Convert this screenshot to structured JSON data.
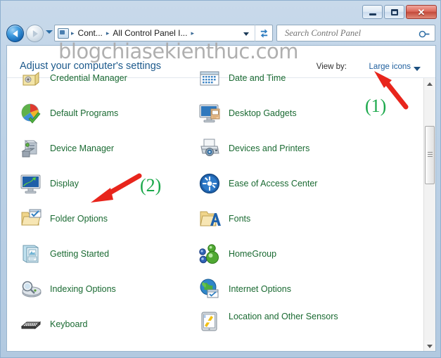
{
  "window": {
    "controls": {
      "minimize_label": "Minimize",
      "maximize_label": "Maximize",
      "close_label": "✕"
    }
  },
  "nav": {
    "back_label": "Back",
    "forward_label": "Forward",
    "history_label": "Recent pages",
    "refresh_label": "Refresh"
  },
  "address": {
    "icon": "control-panel-icon",
    "crumbs": [
      {
        "label": "Cont...",
        "sep": "▸"
      },
      {
        "label": "All Control Panel I...",
        "sep": "▸"
      }
    ],
    "sep_lead": "▸"
  },
  "search": {
    "placeholder": "Search Control Panel",
    "value": "",
    "icon": "search-icon"
  },
  "header": {
    "title": "Adjust your computer's settings",
    "view_by_label": "View by:",
    "view_by_value": "Large icons"
  },
  "watermark": {
    "text": "blogchiasekienthuc.com"
  },
  "items": {
    "left": [
      {
        "label": "Credential Manager",
        "icon": "credential-manager-icon",
        "cut": true
      },
      {
        "label": "Default Programs",
        "icon": "default-programs-icon"
      },
      {
        "label": "Device Manager",
        "icon": "device-manager-icon"
      },
      {
        "label": "Display",
        "icon": "display-icon"
      },
      {
        "label": "Folder Options",
        "icon": "folder-options-icon"
      },
      {
        "label": "Getting Started",
        "icon": "getting-started-icon"
      },
      {
        "label": "Indexing Options",
        "icon": "indexing-options-icon"
      },
      {
        "label": "Keyboard",
        "icon": "keyboard-icon"
      }
    ],
    "right": [
      {
        "label": "Date and Time",
        "icon": "date-and-time-icon",
        "cut": true
      },
      {
        "label": "Desktop Gadgets",
        "icon": "desktop-gadgets-icon"
      },
      {
        "label": "Devices and Printers",
        "icon": "devices-and-printers-icon"
      },
      {
        "label": "Ease of Access Center",
        "icon": "ease-of-access-center-icon"
      },
      {
        "label": "Fonts",
        "icon": "fonts-icon"
      },
      {
        "label": "HomeGroup",
        "icon": "homegroup-icon"
      },
      {
        "label": "Internet Options",
        "icon": "internet-options-icon"
      },
      {
        "label": "Location and Other Sensors",
        "icon": "location-sensors-icon"
      }
    ]
  },
  "annotations": {
    "one": {
      "text": "(1)",
      "color": "#1aa84a",
      "arrow_color": "#e8251c"
    },
    "two": {
      "text": "(2)",
      "color": "#1aa84a",
      "arrow_color": "#e8251c"
    }
  },
  "colors": {
    "link_green": "#1a6a32",
    "title_blue": "#1d5a8c",
    "accent_blue": "#1f5f9e",
    "annotation_red": "#e8251c",
    "annotation_green": "#1aa84a"
  }
}
